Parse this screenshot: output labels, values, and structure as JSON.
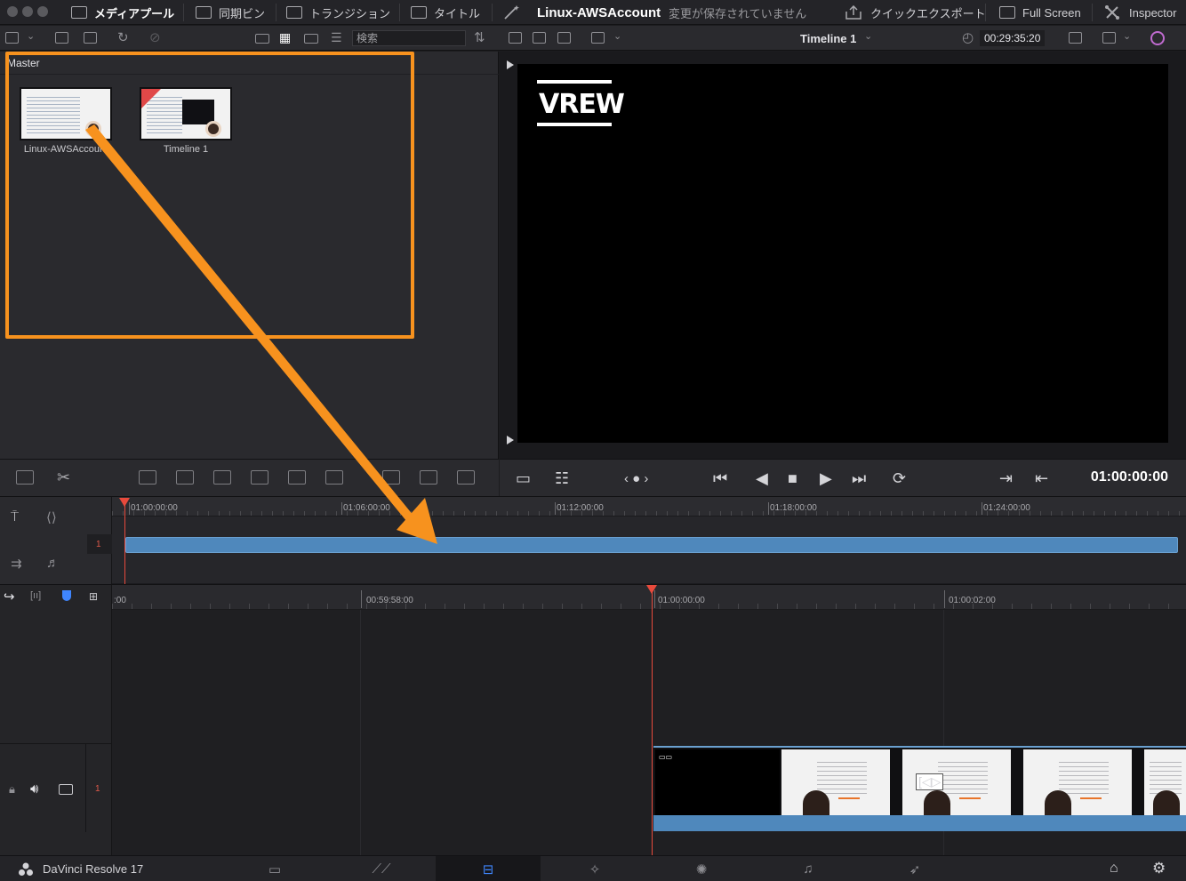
{
  "topbar": {
    "media_pool": "メディアプール",
    "sync_bin": "同期ビン",
    "transitions": "トランジション",
    "titles": "タイトル",
    "project_name": "Linux-AWSAccount",
    "unsaved_status": "変更が保存されていません",
    "quick_export": "クイックエクスポート",
    "full_screen": "Full Screen",
    "inspector": "Inspector"
  },
  "toolbar2": {
    "search_placeholder": "検索",
    "viewer_title": "Timeline 1",
    "duration_timecode": "00:29:35:20"
  },
  "media_pool": {
    "bin_name": "Master",
    "clips": [
      {
        "name": "Linux-AWSAccount",
        "type": "media"
      },
      {
        "name": "Timeline 1",
        "type": "timeline"
      }
    ]
  },
  "viewer": {
    "overlay_logo": "VREW",
    "timecode": "01:00:00:00"
  },
  "upper_timeline": {
    "ruler_labels": [
      "01:00:00:00",
      "01:06:00:00",
      "01:12:00:00",
      "01:18:00:00",
      "01:24:00:00"
    ],
    "track_number": "1"
  },
  "lower_timeline": {
    "ruler_labels": [
      ":00",
      "00:59:58:00",
      "01:00:00:00",
      "01:00:02:00"
    ],
    "track_number": "1"
  },
  "statusbar": {
    "app_name": "DaVinci Resolve 17",
    "active_page": "edit"
  },
  "colors": {
    "accent_blue": "#4f88bc",
    "playhead_red": "#e84a3c",
    "annotation_orange": "#f7921e",
    "active_page_blue": "#3f86ff"
  },
  "icons": {
    "media_pool": "media-pool-icon",
    "sync_bin": "sync-bin-icon",
    "transitions": "transitions-icon",
    "titles": "titles-icon",
    "effects": "magic-wand-icon",
    "quick_export": "export-icon",
    "full_screen": "full-screen-icon",
    "inspector": "inspector-icon"
  }
}
